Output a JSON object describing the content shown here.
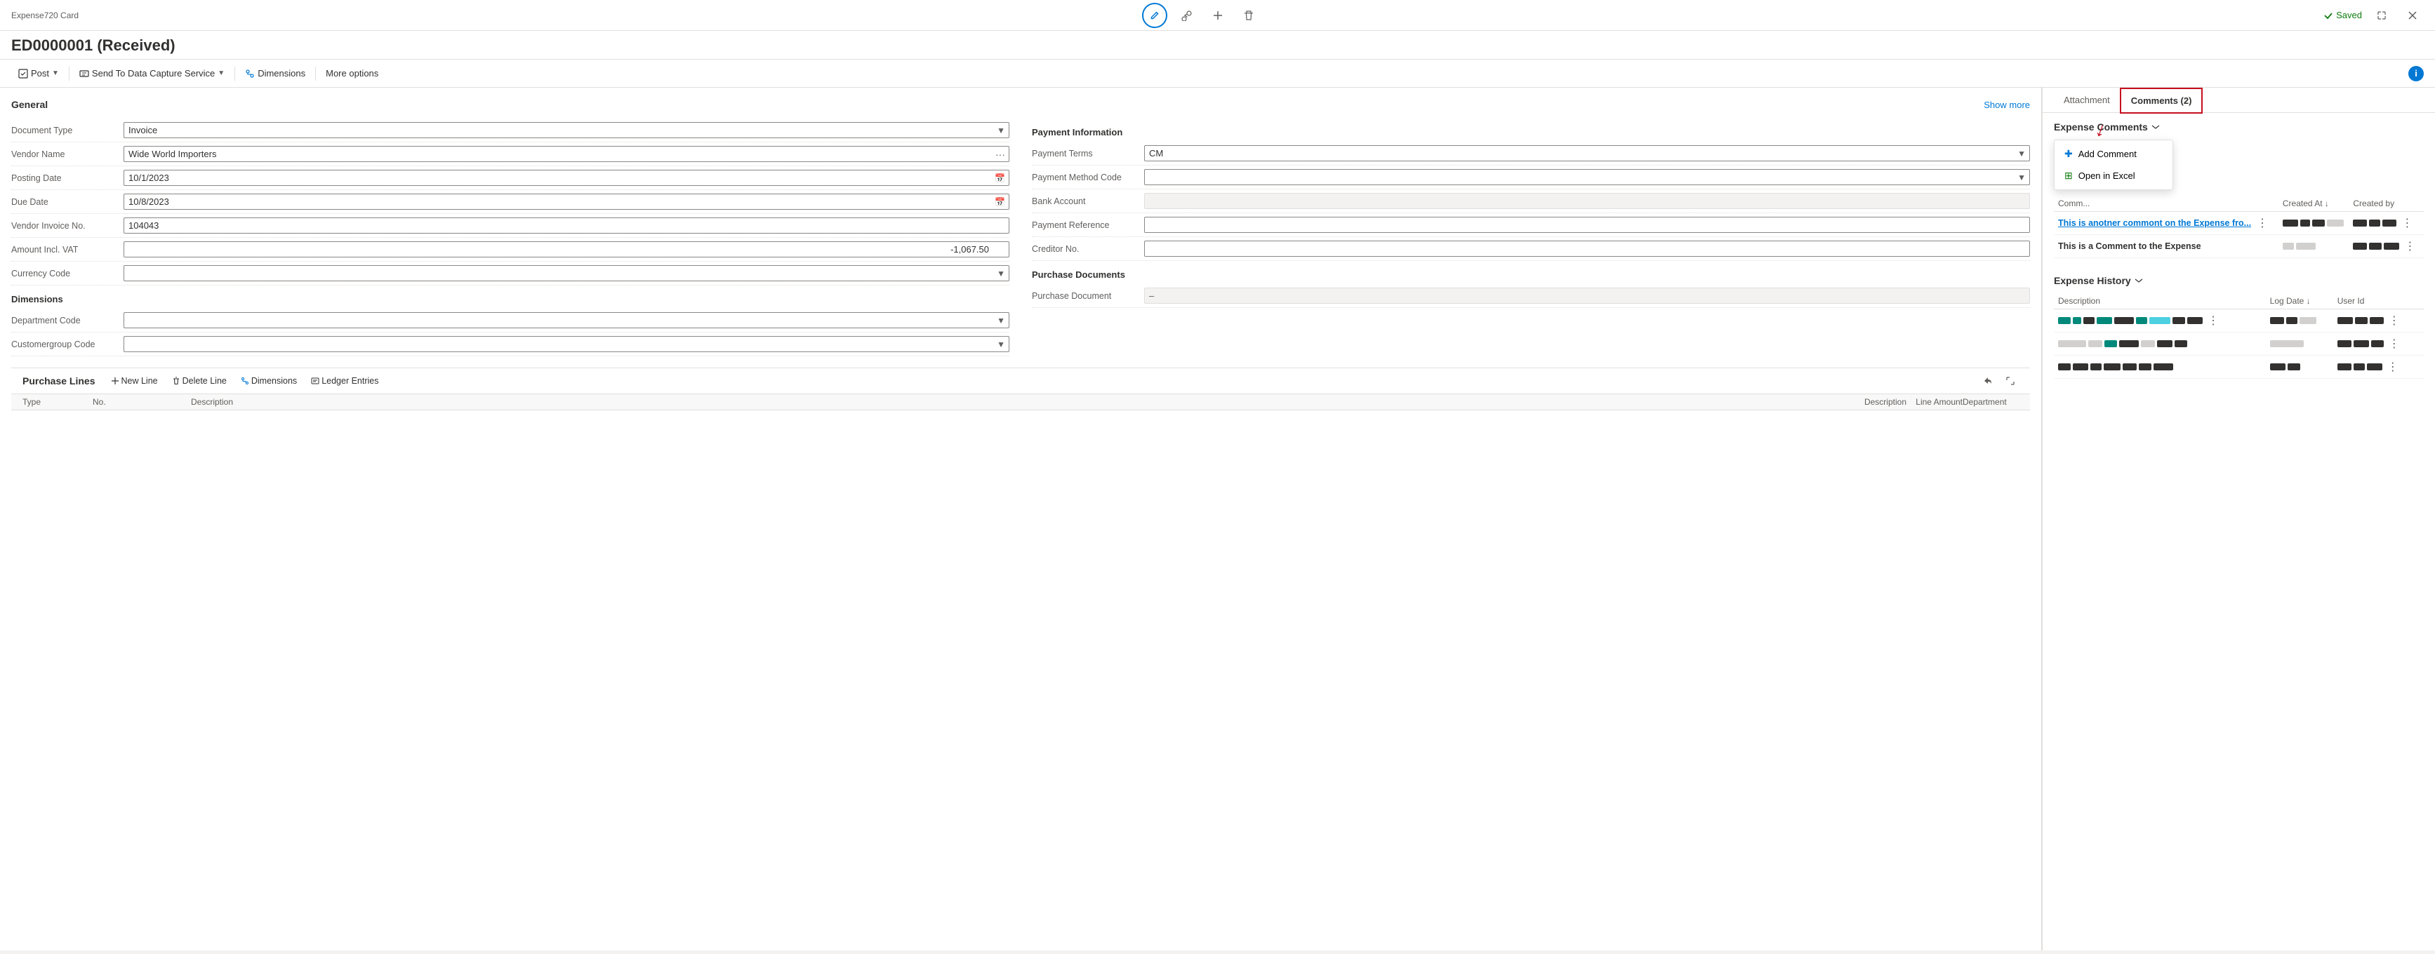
{
  "app": {
    "title": "Expense720 Card",
    "page_title": "ED0000001 (Received)",
    "saved_label": "Saved"
  },
  "actions": {
    "post_label": "Post",
    "send_label": "Send To Data Capture Service",
    "dimensions_label": "Dimensions",
    "more_options_label": "More options"
  },
  "general": {
    "section_title": "General",
    "show_more": "Show more",
    "document_type_label": "Document Type",
    "document_type_value": "Invoice",
    "vendor_name_label": "Vendor Name",
    "vendor_name_value": "Wide World Importers",
    "posting_date_label": "Posting Date",
    "posting_date_value": "10/1/2023",
    "due_date_label": "Due Date",
    "due_date_value": "10/8/2023",
    "vendor_invoice_label": "Vendor Invoice No.",
    "vendor_invoice_value": "104043",
    "amount_vat_label": "Amount Incl. VAT",
    "amount_vat_value": "-1,067.50",
    "currency_code_label": "Currency Code"
  },
  "dimensions": {
    "section_title": "Dimensions",
    "dept_code_label": "Department Code",
    "customer_group_label": "Customergroup Code"
  },
  "payment": {
    "section_title": "Payment Information",
    "terms_label": "Payment Terms",
    "terms_value": "CM",
    "method_label": "Payment Method Code",
    "bank_label": "Bank Account",
    "reference_label": "Payment Reference",
    "creditor_label": "Creditor No."
  },
  "purchase_documents": {
    "section_title": "Purchase Documents",
    "document_label": "Purchase Document",
    "document_value": "–"
  },
  "purchase_lines": {
    "title": "Purchase Lines",
    "new_line": "New Line",
    "delete_line": "Delete Line",
    "dimensions": "Dimensions",
    "ledger_entries": "Ledger Entries"
  },
  "table_headers": {
    "description": "Description",
    "log_date": "Log Date ↓",
    "user_id": "User Id",
    "comment": "Comm...",
    "created_at": "Created At ↓",
    "created_by": "Created by"
  },
  "tabs": {
    "attachment": "Attachment",
    "comments": "Comments (2)"
  },
  "expense_comments": {
    "section_title": "Expense Comments",
    "comment1_text": "This is anotner commont on the Expense fro...",
    "comment2_text": "This is a Comment to the Expense"
  },
  "dropdown": {
    "add_comment": "Add Comment",
    "open_excel": "Open in Excel"
  },
  "expense_history": {
    "section_title": "Expense History"
  }
}
